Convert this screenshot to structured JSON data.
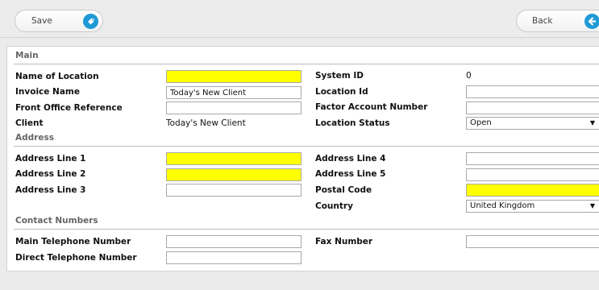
{
  "toolbar": {
    "save_label": "Save",
    "back_label": "Back",
    "colors": {
      "accent": "#1e9ad6"
    },
    "save_icon": "tag-icon",
    "back_icon": "arrow-left-icon"
  },
  "sections": {
    "main": "Main",
    "address": "Address",
    "contact": "Contact Numbers"
  },
  "main": {
    "name_of_location": {
      "label": "Name of Location",
      "value": ""
    },
    "invoice_name": {
      "label": "Invoice Name",
      "value": "Today's New Client"
    },
    "front_office_reference": {
      "label": "Front Office Reference",
      "value": ""
    },
    "client": {
      "label": "Client",
      "value": "Today's New Client"
    },
    "system_id": {
      "label": "System ID",
      "value": "0"
    },
    "location_id": {
      "label": "Location Id",
      "value": ""
    },
    "factor_account_number": {
      "label": "Factor Account Number",
      "value": ""
    },
    "location_status": {
      "label": "Location Status",
      "value": "Open"
    }
  },
  "address": {
    "line1": {
      "label": "Address Line 1",
      "value": ""
    },
    "line2": {
      "label": "Address Line 2",
      "value": ""
    },
    "line3": {
      "label": "Address Line 3",
      "value": ""
    },
    "line4": {
      "label": "Address Line 4",
      "value": ""
    },
    "line5": {
      "label": "Address Line 5",
      "value": ""
    },
    "postal_code": {
      "label": "Postal Code",
      "value": ""
    },
    "country": {
      "label": "Country",
      "value": "United Kingdom"
    }
  },
  "contact": {
    "main_telephone": {
      "label": "Main Telephone Number",
      "value": ""
    },
    "direct_telephone": {
      "label": "Direct Telephone Number",
      "value": ""
    },
    "fax_number": {
      "label": "Fax Number",
      "value": ""
    }
  },
  "colors": {
    "required_field": "#ffff00"
  }
}
